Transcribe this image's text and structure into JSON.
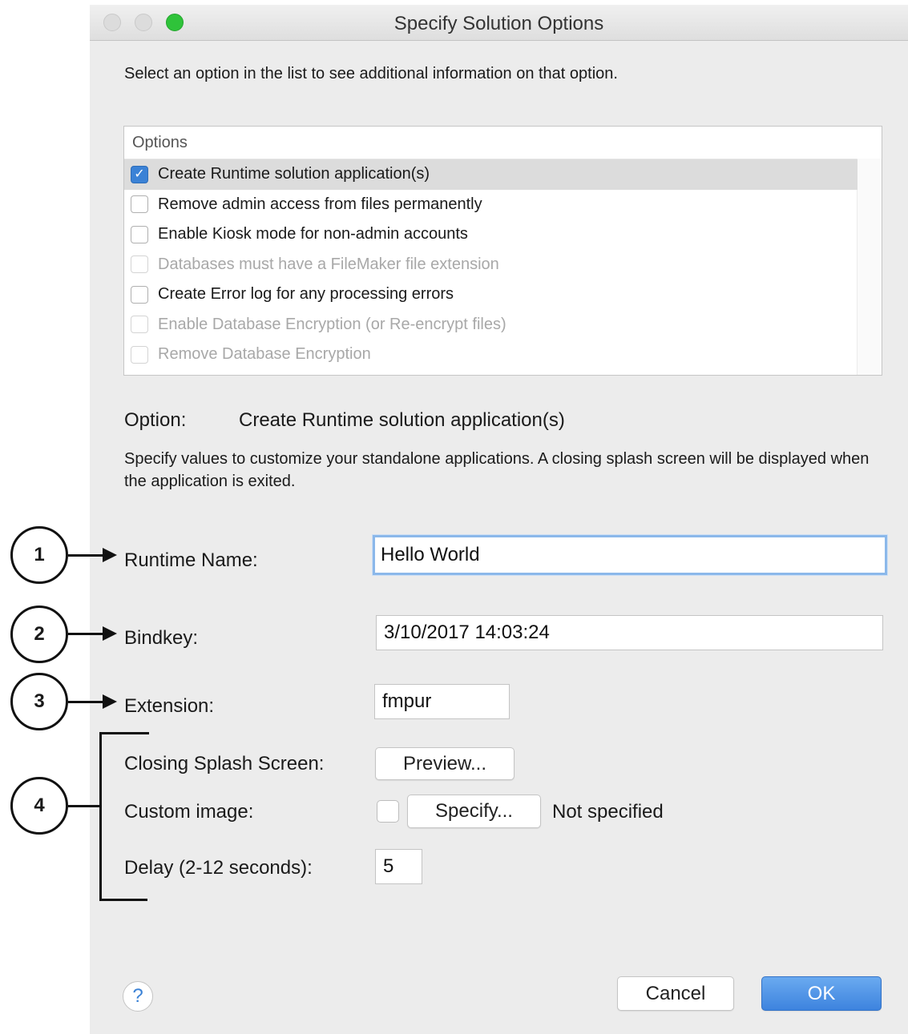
{
  "window": {
    "title": "Specify Solution Options"
  },
  "instruction": "Select an option in the list to see additional information on that option.",
  "options": {
    "header": "Options",
    "items": [
      {
        "label": "Create Runtime solution application(s)",
        "checked": true,
        "enabled": true,
        "selected": true
      },
      {
        "label": "Remove admin access from files permanently",
        "checked": false,
        "enabled": true,
        "selected": false
      },
      {
        "label": "Enable Kiosk mode for non-admin accounts",
        "checked": false,
        "enabled": true,
        "selected": false
      },
      {
        "label": "Databases must have a FileMaker file extension",
        "checked": false,
        "enabled": false,
        "selected": false
      },
      {
        "label": "Create Error log for any processing errors",
        "checked": false,
        "enabled": true,
        "selected": false
      },
      {
        "label": "Enable Database Encryption (or Re-encrypt files)",
        "checked": false,
        "enabled": false,
        "selected": false
      },
      {
        "label": "Remove Database Encryption",
        "checked": false,
        "enabled": false,
        "selected": false
      }
    ]
  },
  "option_detail": {
    "label": "Option:",
    "value": "Create Runtime solution application(s)",
    "description": "Specify values to customize your standalone applications. A closing splash screen will be displayed when the application is exited."
  },
  "fields": {
    "runtime_name": {
      "label": "Runtime Name:",
      "value": "Hello World"
    },
    "bindkey": {
      "label": "Bindkey:",
      "value": "3/10/2017 14:03:24"
    },
    "extension": {
      "label": "Extension:",
      "value": "fmpur"
    },
    "closing_splash": {
      "label": "Closing Splash Screen:",
      "button": "Preview..."
    },
    "custom_image": {
      "label": "Custom image:",
      "button": "Specify...",
      "status": "Not specified",
      "checked": false
    },
    "delay": {
      "label": "Delay (2-12 seconds):",
      "value": "5"
    }
  },
  "footer": {
    "help": "?",
    "cancel": "Cancel",
    "ok": "OK"
  },
  "callouts": [
    "1",
    "2",
    "3",
    "4"
  ],
  "colors": {
    "accent": "#3b82d6",
    "zoom_button": "#2fc33a",
    "window_bg": "#ececec"
  }
}
